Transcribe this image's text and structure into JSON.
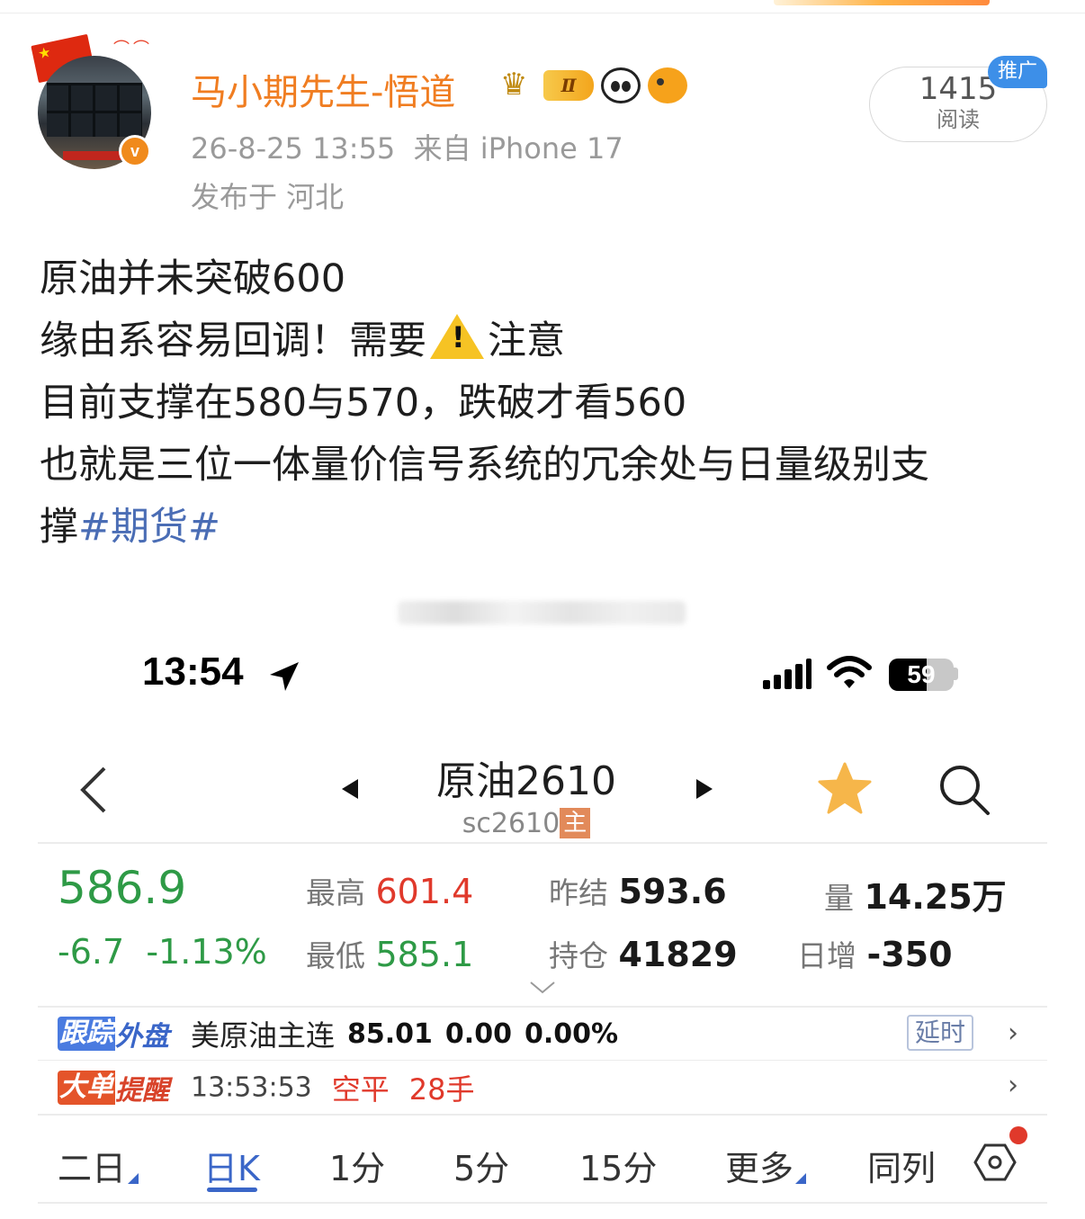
{
  "post": {
    "author": "马小期先生-悟道",
    "rank_badge": "Ⅱ",
    "time": "26-8-25 13:55",
    "source": "来自 iPhone 17",
    "location": "发布于 河北",
    "reads_count": "1415",
    "reads_label": "阅读",
    "promo_label": "推广",
    "lines": [
      "原油并未突破600",
      "缘由系容易回调！需要",
      "注意",
      "目前支撑在580与570，跌破才看560",
      "也就是三位一体量价信号系统的冗余处与日量级别支",
      "撑"
    ],
    "hashtag": "#期货#",
    "icons": [
      "verified-badge-icon",
      "crown-icon",
      "panda-icon",
      "fish-icon",
      "warning-icon"
    ],
    "colors": {
      "author": "#f07d21",
      "hashtag": "#4a6db5",
      "verified": "#f08a1c"
    }
  },
  "screenshot": {
    "status_bar": {
      "time": "13:54",
      "battery": "59",
      "battery_level": 0.59,
      "icons": [
        "location-arrow-icon",
        "signal-icon",
        "wifi-icon",
        "battery-icon"
      ]
    },
    "header": {
      "title": "原油2610",
      "code": "sc2610",
      "main_tag": "主",
      "icons": [
        "back-icon",
        "prev-arrow-icon",
        "next-arrow-icon",
        "star-icon",
        "search-icon"
      ]
    },
    "quote": {
      "price": "586.9",
      "change": "-6.7",
      "change_pct": "-1.13%",
      "high_label": "最高",
      "high": "601.4",
      "low_label": "最低",
      "low": "585.1",
      "settle_label": "昨结",
      "settle": "593.6",
      "oi_label": "持仓",
      "oi": "41829",
      "volume_label": "量",
      "volume": "14.25万",
      "daily_label": "日增",
      "daily": "-350",
      "colors": {
        "down": "#2e9a46",
        "up": "#e0392b"
      }
    },
    "tracking": {
      "tag1": "跟踪",
      "tag2": "外盘",
      "name": "美原油主连",
      "price": "85.01",
      "change": "0.00",
      "pct": "0.00%",
      "delay": "延时"
    },
    "big_order": {
      "tag1": "大单",
      "tag2": "提醒",
      "time": "13:53:53",
      "type": "空平",
      "qty": "28手"
    },
    "tabs": {
      "items": [
        "二日",
        "日K",
        "1分",
        "5分",
        "15分",
        "更多",
        "同列"
      ],
      "active": "日K"
    }
  }
}
